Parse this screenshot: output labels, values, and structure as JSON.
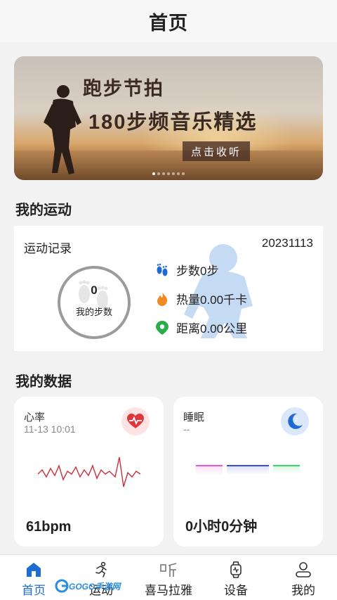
{
  "header": {
    "title": "首页"
  },
  "banner": {
    "headline": "跑步节拍",
    "subline": "180步频音乐精选",
    "cta": "点击收听",
    "slide_count": 7,
    "active_slide": 0
  },
  "sections": {
    "my_sport": "我的运动",
    "my_data": "我的数据"
  },
  "sport_card": {
    "label": "运动记录",
    "date": "20231113",
    "steps_value": "0",
    "steps_caption": "我的步数",
    "stats": [
      {
        "icon": "footprints-icon",
        "text": "步数0步",
        "color": "#1e6bd6"
      },
      {
        "icon": "flame-icon",
        "text": "热量0.00千卡",
        "color": "#f08a24"
      },
      {
        "icon": "location-pin-icon",
        "text": "距离0.00公里",
        "color": "#2bab4a"
      }
    ]
  },
  "heart_card": {
    "title": "心率",
    "time": "11-13 10:01",
    "value": "61bpm",
    "accent": "#e0363a"
  },
  "sleep_card": {
    "title": "睡眠",
    "time": "--",
    "value": "0小时0分钟",
    "accent": "#1e6bd6",
    "bar_colors": [
      "#e25ad9",
      "#3b4fd6",
      "#3ad86a"
    ]
  },
  "tabbar": {
    "tabs": [
      {
        "label": "首页",
        "icon": "home-icon",
        "active": true
      },
      {
        "label": "运动",
        "icon": "running-icon",
        "active": false
      },
      {
        "label": "喜马拉雅",
        "icon": "ting-icon",
        "active": false
      },
      {
        "label": "设备",
        "icon": "watch-icon",
        "active": false
      },
      {
        "label": "我的",
        "icon": "user-icon",
        "active": false
      }
    ],
    "active_color": "#1e6bd6"
  },
  "watermark": {
    "text": "GOGO手游网"
  }
}
